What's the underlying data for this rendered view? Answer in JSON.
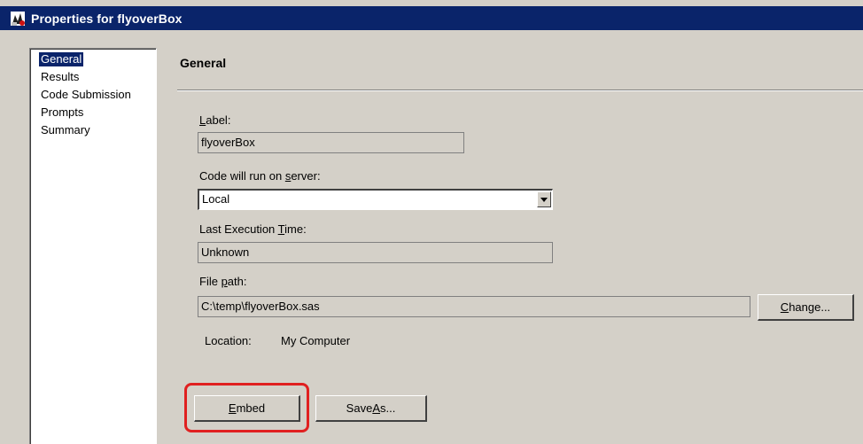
{
  "window": {
    "title": "Properties for flyoverBox"
  },
  "nav": {
    "items": [
      {
        "label": "General",
        "selected": true
      },
      {
        "label": "Results",
        "selected": false
      },
      {
        "label": "Code Submission",
        "selected": false
      },
      {
        "label": "Prompts",
        "selected": false
      },
      {
        "label": "Summary",
        "selected": false
      }
    ]
  },
  "section": {
    "title": "General"
  },
  "form": {
    "label_caption_accel": "L",
    "label_caption_rest": "abel:",
    "label_value": "flyoverBox",
    "server_caption_pre": "Code will run on ",
    "server_caption_accel": "s",
    "server_caption_rest": "erver:",
    "server_value": "Local",
    "last_exec_caption_pre": "Last Execution ",
    "last_exec_caption_accel": "T",
    "last_exec_caption_rest": "ime:",
    "last_exec_value": "Unknown",
    "file_path_caption_pre": "File ",
    "file_path_caption_accel": "p",
    "file_path_caption_rest": "ath:",
    "file_path_value": "C:\\temp\\flyoverBox.sas",
    "change_button_accel": "C",
    "change_button_rest": "hange...",
    "location_caption": "Location:",
    "location_value": "My Computer"
  },
  "buttons": {
    "embed_accel": "E",
    "embed_rest": "mbed",
    "save_as_pre": "Save ",
    "save_as_accel": "A",
    "save_as_rest": "s..."
  },
  "colors": {
    "titlebar": "#0a246a",
    "dialog_bg": "#d4d0c8",
    "highlight": "#e02020"
  },
  "icons": {
    "title": "properties-app-icon",
    "dropdown": "dropdown-arrow-icon"
  }
}
